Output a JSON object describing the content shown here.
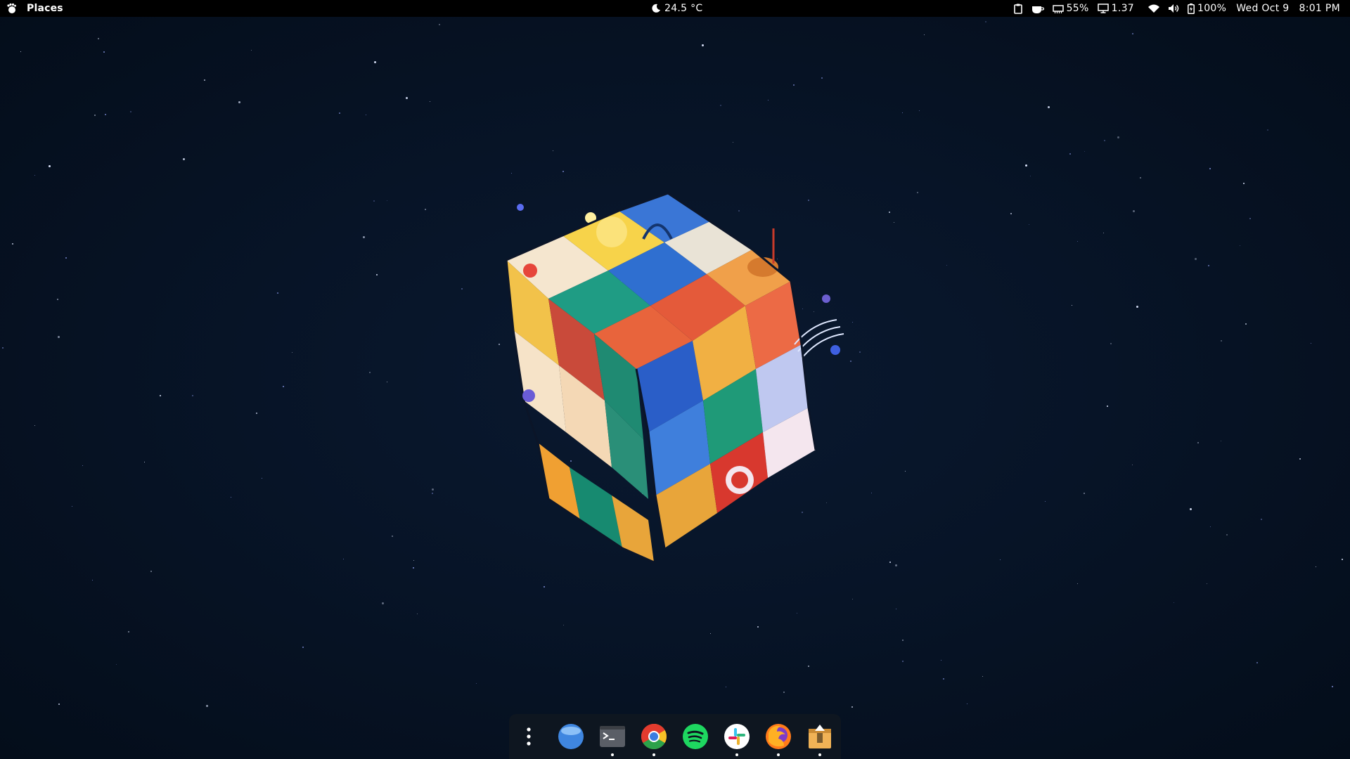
{
  "topbar": {
    "activities_icon": "gnome-foot-icon",
    "places_label": "Places",
    "weather": {
      "icon": "moon-icon",
      "temperature": "24.5 °C"
    },
    "indicators": [
      {
        "name": "clipboard-icon"
      },
      {
        "name": "caffeine-cup-icon"
      }
    ],
    "memory": {
      "icon": "memory-chip-icon",
      "value": "55%"
    },
    "load": {
      "icon": "monitor-icon",
      "value": "1.37"
    },
    "network_icon": "wifi-icon",
    "volume_icon": "speaker-icon",
    "battery": {
      "icon": "battery-icon",
      "value": "100%"
    },
    "date": "Wed Oct 9",
    "time": "8:01 PM"
  },
  "wallpaper": {
    "description_icon": "rubiks-cube-illustration",
    "colors": {
      "background": "#061120",
      "star": "#dfe8ff"
    }
  },
  "dock": {
    "apps": [
      {
        "name": "show-apps",
        "icon": "vertical-dots-icon",
        "running": false
      },
      {
        "name": "files",
        "icon": "files-icon",
        "running": false
      },
      {
        "name": "terminal",
        "icon": "terminal-icon",
        "running": true
      },
      {
        "name": "chrome",
        "icon": "chrome-icon",
        "running": true
      },
      {
        "name": "spotify",
        "icon": "spotify-icon",
        "running": false
      },
      {
        "name": "slack",
        "icon": "slack-icon",
        "running": true
      },
      {
        "name": "firefox",
        "icon": "firefox-icon",
        "running": true
      },
      {
        "name": "archive-manager",
        "icon": "archive-icon",
        "running": true
      }
    ]
  }
}
